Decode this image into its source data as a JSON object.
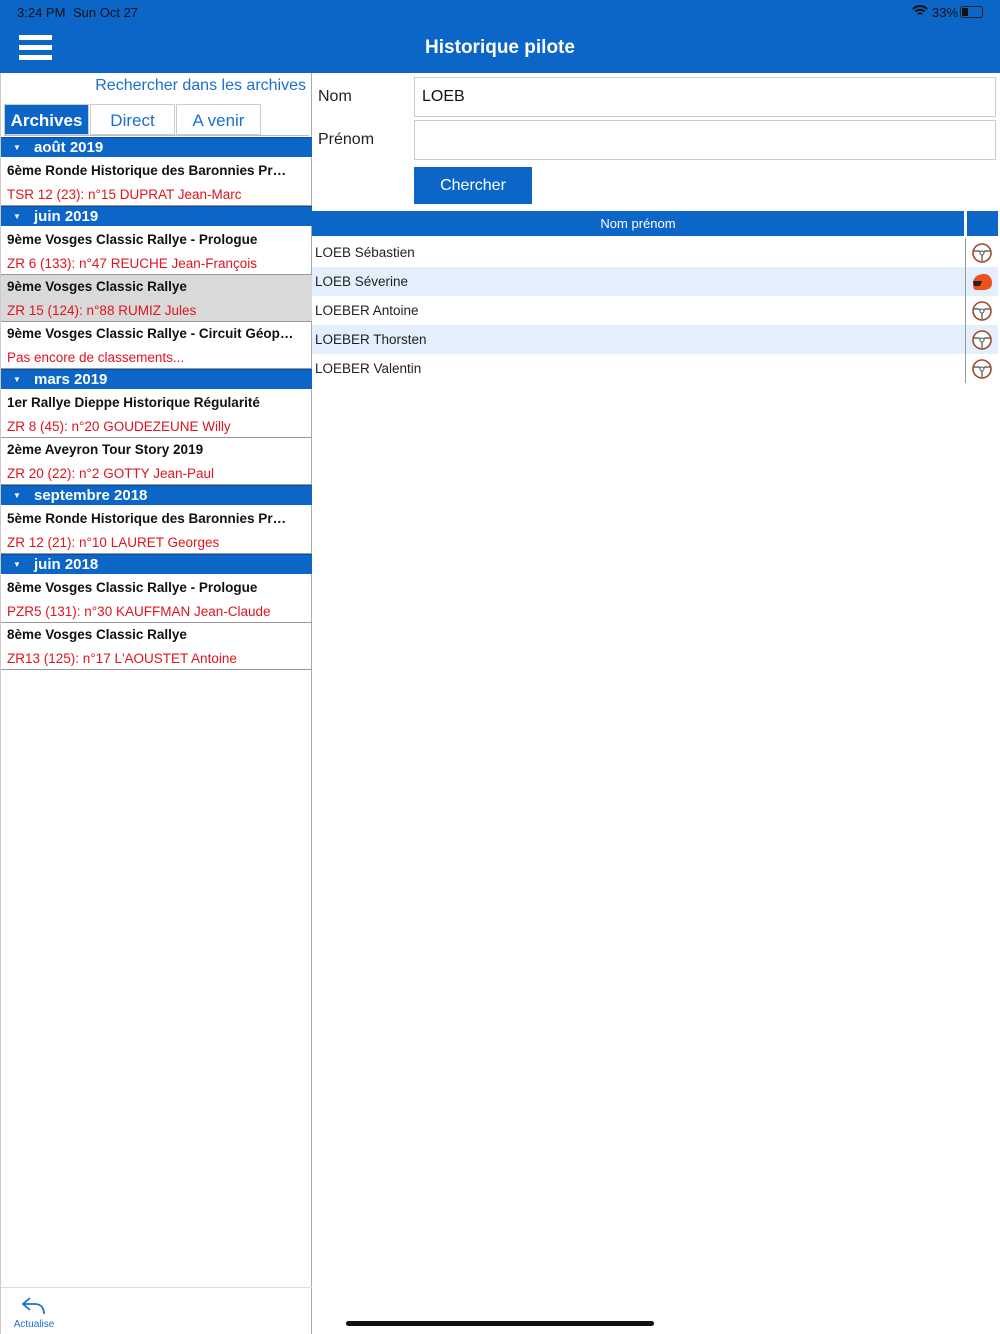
{
  "status": {
    "time": "3:24 PM",
    "date": "Sun Oct 27",
    "battery": "33%",
    "battery_level": 0.33
  },
  "header": {
    "title": "Historique pilote"
  },
  "left": {
    "search_link": "Rechercher dans les archives",
    "tabs": [
      {
        "label": "Archives",
        "active": true
      },
      {
        "label": "Direct"
      },
      {
        "label": "A venir"
      }
    ],
    "sections": [
      {
        "label": "août 2019",
        "items": [
          {
            "title": "6ème Ronde Historique des Baronnies Pr…",
            "sub": "TSR 12 (23): n°15 DUPRAT Jean-Marc"
          }
        ]
      },
      {
        "label": "juin 2019",
        "items": [
          {
            "title": "9ème Vosges Classic Rallye - Prologue",
            "sub": "ZR 6 (133): n°47 REUCHE Jean-François"
          },
          {
            "title": "9ème Vosges Classic Rallye",
            "sub": "ZR 15 (124): n°88 RUMIZ Jules",
            "selected": true
          },
          {
            "title": "9ème Vosges Classic Rallye - Circuit Géop…",
            "sub": "Pas encore de classements..."
          }
        ]
      },
      {
        "label": "mars 2019",
        "items": [
          {
            "title": "1er Rallye Dieppe Historique Régularité",
            "sub": "ZR 8 (45): n°20 GOUDEZEUNE Willy"
          },
          {
            "title": "2ème Aveyron Tour Story 2019",
            "sub": "ZR 20 (22): n°2 GOTTY Jean-Paul"
          }
        ]
      },
      {
        "label": "septembre 2018",
        "items": [
          {
            "title": "5ème Ronde Historique des Baronnies Pr…",
            "sub": "ZR 12 (21): n°10 LAURET Georges"
          }
        ]
      },
      {
        "label": "juin 2018",
        "items": [
          {
            "title": "8ème Vosges Classic Rallye - Prologue",
            "sub": " PZR5 (131): n°30 KAUFFMAN Jean-Claude"
          },
          {
            "title": "8ème Vosges Classic Rallye",
            "sub": " ZR13 (125): n°17 L'AOUSTET Antoine"
          }
        ]
      }
    ],
    "refresh_label": "Actualise"
  },
  "form": {
    "nom_label": "Nom",
    "nom_value": "LOEB",
    "prenom_label": "Prénom",
    "prenom_value": "",
    "search_button": "Chercher"
  },
  "results": {
    "column": "Nom prénom",
    "rows": [
      {
        "name": "LOEB Sébastien",
        "icon": "steering-wheel-icon"
      },
      {
        "name": "LOEB Séverine",
        "icon": "helmet-icon"
      },
      {
        "name": "LOEBER Antoine",
        "icon": "steering-wheel-icon"
      },
      {
        "name": "LOEBER Thorsten",
        "icon": "steering-wheel-icon"
      },
      {
        "name": "LOEBER Valentin",
        "icon": "steering-wheel-icon"
      }
    ]
  },
  "colors": {
    "brand": "#0b66c8",
    "subtitle": "#e0141e",
    "alt_row": "#e3effc"
  }
}
